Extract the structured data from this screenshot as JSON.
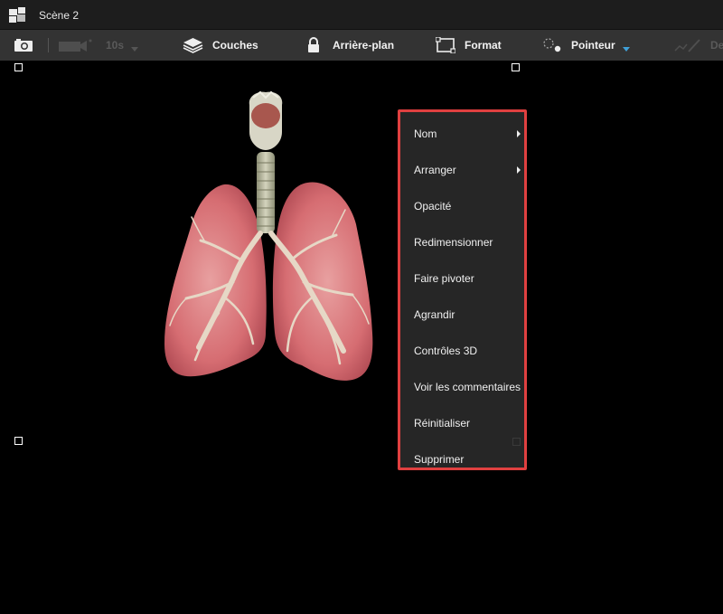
{
  "window": {
    "title": "Scène 2",
    "app_icon": "app-logo-icon"
  },
  "toolbar": {
    "camera_icon": "camera-icon",
    "video_icon": "video-camera-icon",
    "duration": "10s",
    "layers_label": "Couches",
    "layers_icon": "layers-icon",
    "background_label": "Arrière-plan",
    "background_icon": "lock-icon",
    "format_label": "Format",
    "format_icon": "frame-icon",
    "pointer_label": "Pointeur",
    "pointer_icon": "pointer-icon",
    "draw_label": "De",
    "draw_icon": "pen-icon"
  },
  "canvas": {
    "model": "3D lungs and trachea model"
  },
  "context_menu": {
    "items": [
      {
        "label": "Nom",
        "has_submenu": true
      },
      {
        "label": "Arranger",
        "has_submenu": true
      },
      {
        "label": "Opacité",
        "has_submenu": false
      },
      {
        "label": "Redimensionner",
        "has_submenu": false
      },
      {
        "label": "Faire pivoter",
        "has_submenu": false
      },
      {
        "label": "Agrandir",
        "has_submenu": false
      },
      {
        "label": "Contrôles 3D",
        "has_submenu": false
      },
      {
        "label": "Voir les commentaires",
        "has_submenu": false
      },
      {
        "label": "Réinitialiser",
        "has_submenu": false
      },
      {
        "label": "Supprimer",
        "has_submenu": false
      }
    ]
  },
  "colors": {
    "highlight_border": "#e04040",
    "menu_bg": "#262626",
    "toolbar_bg": "#333333",
    "accent": "#3fa0d8"
  }
}
